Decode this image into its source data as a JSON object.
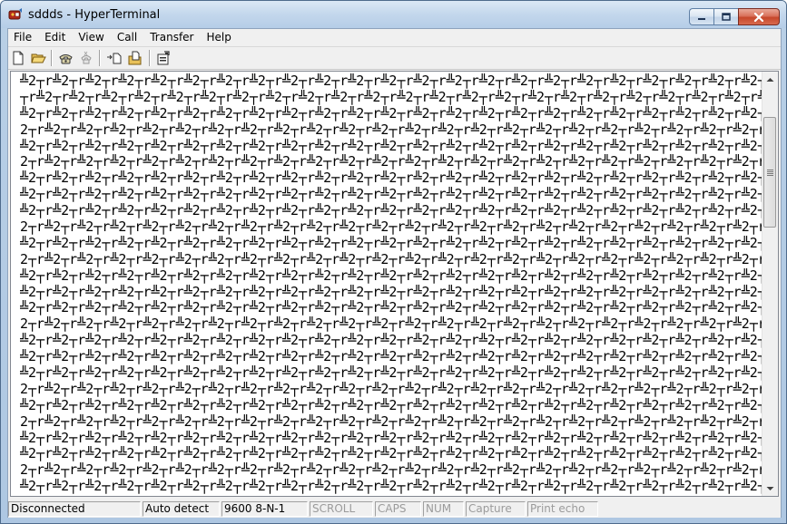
{
  "window": {
    "title": "sddds - HyperTerminal",
    "app_icon": "hyperterminal-icon",
    "caption_buttons": [
      "minimize-icon",
      "maximize-icon",
      "close-icon"
    ]
  },
  "menu": {
    "items": [
      {
        "label": "File"
      },
      {
        "label": "Edit"
      },
      {
        "label": "View"
      },
      {
        "label": "Call"
      },
      {
        "label": "Transfer"
      },
      {
        "label": "Help"
      }
    ]
  },
  "toolbar": {
    "buttons": [
      "new-connection-icon",
      "open-icon",
      "call-icon",
      "disconnect-icon",
      "send-file-icon",
      "receive-file-icon",
      "properties-icon"
    ]
  },
  "terminal": {
    "row_pattern_a": "╩2┬r╩2┬r╩2┬r╩2┬r╩2┬r╩2┬r╩2┬r╩2┬r╩2┬r╩2┬r╩2┬r╩2┬r╩2┬r╩2┬r╩2┬r╩2┬r╩2┬r╩2┬r╩2┬r╩2┬r╩2┬r╩2┬r╩2┬r╩2┬r╩2┬r",
    "row_pattern_b": "2┬r╩2┬r╩2┬r╩2┬r╩2┬r╩2┬r╩2┬r╩2┬r╩2┬r╩2┬r╩2┬r╩2┬r╩2┬r╩2┬r╩2┬r╩2┬r╩2┬r╩2┬r╩2┬r╩2┬r╩2┬r╩2┬r╩2┬r╩2┬r╩2┬r",
    "rows": [
      "╩2┬r╩2┬r╩2┬r╩2┬r╩2┬r╩2┬r╩2┬r╩2┬r╩2┬r╩2┬r╩2┬r╩2┬r╩2┬r╩2┬r╩2┬r╩2┬r╩2┬r╩2┬r╩2┬r╩2┬r╩2┬r╩2┬r╩2┬r╩2┬r╩2┬r",
      "┬r╩2┬r╩2┬r╩2┬r╩2┬r╩2┬r╩2┬r╩2┬r╩2┬r╩2┬r╩2┬r╩2┬r╩2┬r╩2┬r╩2┬r╩2┬r╩2┬r╩2┬r╩2┬r╩2┬r╩2┬r╩2┬r╩2┬r╩2┬r╩2┬r╩2",
      "╩2┬r╩2┬r╩2┬r╩2┬r╩2┬r╩2┬r╩2┬r╩2┬r╩2┬r╩2┬r╩2┬r╩2┬r╩2┬r╩2┬r╩2┬r╩2┬r╩2┬r╩2┬r╩2┬r╩2┬r╩2┬r╩2┬r╩2┬r╩2┬r╩2┬r",
      "2┬r╩2┬r╩2┬r╩2┬r╩2┬r╩2┬r╩2┬r╩2┬r╩2┬r╩2┬r╩2┬r╩2┬r╩2┬r╩2┬r╩2┬r╩2┬r╩2┬r╩2┬r╩2┬r╩2┬r╩2┬r╩2┬r╩2┬r╩2┬r╩2┬r╩",
      "╩2┬r╩2┬r╩2┬r╩2┬r╩2┬r╩2┬r╩2┬r╩2┬r╩2┬r╩2┬r╩2┬r╩2┬r╩2┬r╩2┬r╩2┬r╩2┬r╩2┬r╩2┬r╩2┬r╩2┬r╩2┬r╩2┬r╩2┬r╩2┬r╩2┬r",
      "2┬r╩2┬r╩2┬r╩2┬r╩2┬r╩2┬r╩2┬r╩2┬r╩2┬r╩2┬r╩2┬r╩2┬r╩2┬r╩2┬r╩2┬r╩2┬r╩2┬r╩2┬r╩2┬r╩2┬r╩2┬r╩2┬r╩2┬r╩2┬r╩2┬r╩",
      "╩2┬r╩2┬r╩2┬r╩2┬r╩2┬r╩2┬r╩2┬r╩2┬r╩2┬r╩2┬r╩2┬r╩2┬r╩2┬r╩2┬r╩2┬r╩2┬r╩2┬r╩2┬r╩2┬r╩2┬r╩2┬r╩2┬r╩2┬r╩2┬r╩2┬r",
      "╩2┬r╩2┬r╩2┬r╩2┬r╩2┬r╩2┬r╩2┬r╩2┬r╩2┬r╩2┬r╩2┬r╩2┬r╩2┬r╩2┬r╩2┬r╩2┬r╩2┬r╩2┬r╩2┬r╩2┬r╩2┬r╩2┬r╩2┬r╩2┬r╩2┬r",
      "╩2┬r╩2┬r╩2┬r╩2┬r╩2┬r╩2┬r╩2┬r╩2┬r╩2┬r╩2┬r╩2┬r╩2┬r╩2┬r╩2┬r╩2┬r╩2┬r╩2┬r╩2┬r╩2┬r╩2┬r╩2┬r╩2┬r╩2┬r╩2┬r╩2┬r",
      "2┬r╩2┬r╩2┬r╩2┬r╩2┬r╩2┬r╩2┬r╩2┬r╩2┬r╩2┬r╩2┬r╩2┬r╩2┬r╩2┬r╩2┬r╩2┬r╩2┬r╩2┬r╩2┬r╩2┬r╩2┬r╩2┬r╩2┬r╩2┬r╩2┬r╩",
      "╩2┬r╩2┬r╩2┬r╩2┬r╩2┬r╩2┬r╩2┬r╩2┬r╩2┬r╩2┬r╩2┬r╩2┬r╩2┬r╩2┬r╩2┬r╩2┬r╩2┬r╩2┬r╩2┬r╩2┬r╩2┬r╩2┬r╩2┬r╩2┬r╩2┬r",
      "2┬r╩2┬r╩2┬r╩2┬r╩2┬r╩2┬r╩2┬r╩2┬r╩2┬r╩2┬r╩2┬r╩2┬r╩2┬r╩2┬r╩2┬r╩2┬r╩2┬r╩2┬r╩2┬r╩2┬r╩2┬r╩2┬r╩2┬r╩2┬r╩2┬r╩",
      "╩2┬r╩2┬r╩2┬r╩2┬r╩2┬r╩2┬r╩2┬r╩2┬r╩2┬r╩2┬r╩2┬r╩2┬r╩2┬r╩2┬r╩2┬r╩2┬r╩2┬r╩2┬r╩2┬r╩2┬r╩2┬r╩2┬r╩2┬r╩2┬r╩2┬r",
      "╩2┬r╩2┬r╩2┬r╩2┬r╩2┬r╩2┬r╩2┬r╩2┬r╩2┬r╩2┬r╩2┬r╩2┬r╩2┬r╩2┬r╩2┬r╩2┬r╩2┬r╩2┬r╩2┬r╩2┬r╩2┬r╩2┬r╩2┬r╩2┬r╩2┬r",
      "╩2┬r╩2┬r╩2┬r╩2┬r╩2┬r╩2┬r╩2┬r╩2┬r╩2┬r╩2┬r╩2┬r╩2┬r╩2┬r╩2┬r╩2┬r╩2┬r╩2┬r╩2┬r╩2┬r╩2┬r╩2┬r╩2┬r╩2┬r╩2┬r╩2┬r",
      "2┬r╩2┬r╩2┬r╩2┬r╩2┬r╩2┬r╩2┬r╩2┬r╩2┬r╩2┬r╩2┬r╩2┬r╩2┬r╩2┬r╩2┬r╩2┬r╩2┬r╩2┬r╩2┬r╩2┬r╩2┬r╩2┬r╩2┬r╩2┬r╩2┬r╩",
      "╩2┬r╩2┬r╩2┬r╩2┬r╩2┬r╩2┬r╩2┬r╩2┬r╩2┬r╩2┬r╩2┬r╩2┬r╩2┬r╩2┬r╩2┬r╩2┬r╩2┬r╩2┬r╩2┬r╩2┬r╩2┬r╩2┬r╩2┬r╩2┬r╩2┬r",
      "╩2┬r╩2┬r╩2┬r╩2┬r╩2┬r╩2┬r╩2┬r╩2┬r╩2┬r╩2┬r╩2┬r╩2┬r╩2┬r╩2┬r╩2┬r╩2┬r╩2┬r╩2┬r╩2┬r╩2┬r╩2┬r╩2┬r╩2┬r╩2┬r╩2┬r",
      "╩2┬r╩2┬r╩2┬r╩2┬r╩2┬r╩2┬r╩2┬r╩2┬r╩2┬r╩2┬r╩2┬r╩2┬r╩2┬r╩2┬r╩2┬r╩2┬r╩2┬r╩2┬r╩2┬r╩2┬r╩2┬r╩2┬r╩2┬r╩2┬r╩2┬r",
      "2┬r╩2┬r╩2┬r╩2┬r╩2┬r╩2┬r╩2┬r╩2┬r╩2┬r╩2┬r╩2┬r╩2┬r╩2┬r╩2┬r╩2┬r╩2┬r╩2┬r╩2┬r╩2┬r╩2┬r╩2┬r╩2┬r╩2┬r╩2┬r╩2┬r╩",
      "╩2┬r╩2┬r╩2┬r╩2┬r╩2┬r╩2┬r╩2┬r╩2┬r╩2┬r╩2┬r╩2┬r╩2┬r╩2┬r╩2┬r╩2┬r╩2┬r╩2┬r╩2┬r╩2┬r╩2┬r╩2┬r╩2┬r╩2┬r╩2┬r╩2┬r",
      "2┬r╩2┬r╩2┬r╩2┬r╩2┬r╩2┬r╩2┬r╩2┬r╩2┬r╩2┬r╩2┬r╩2┬r╩2┬r╩2┬r╩2┬r╩2┬r╩2┬r╩2┬r╩2┬r╩2┬r╩2┬r╩2┬r╩2┬r╩2┬r╩2┬r╩",
      "╩2┬r╩2┬r╩2┬r╩2┬r╩2┬r╩2┬r╩2┬r╩2┬r╩2┬r╩2┬r╩2┬r╩2┬r╩2┬r╩2┬r╩2┬r╩2┬r╩2┬r╩2┬r╩2┬r╩2┬r╩2┬r╩2┬r╩2┬r╩2┬r╩2┬r",
      "╩2┬r╩2┬r╩2┬r╩2┬r╩2┬r╩2┬r╩2┬r╩2┬r╩2┬r╩2┬r╩2┬r╩2┬r╩2┬r╩2┬r╩2┬r╩2┬r╩2┬r╩2┬r╩2┬r╩2┬r╩2┬r╩2┬r╩2┬r╩2┬r╩2┬r",
      "2┬r╩2┬r╩2┬r╩2┬r╩2┬r╩2┬r╩2┬r╩2┬r╩2┬r╩2┬r╩2┬r╩2┬r╩2┬r╩2┬r╩2┬r╩2┬r╩2┬r╩2┬r╩2┬r╩2┬r╩2┬r╩2┬r╩2┬r╩2┬r╩2┬r╩",
      "╩2┬r╩2┬r╩2┬r╩2┬r╩2┬r╩2┬r╩2┬r╩2┬r╩2┬r╩2┬r╩2┬r╩2┬r╩2┬r╩2┬r╩2┬r╩2┬r╩2┬r╩2┬r╩2┬r╩2┬r╩2┬r╩2┬r╩2┬r╩2┬r╩2┬r"
    ]
  },
  "statusbar": {
    "connection": "Disconnected",
    "detect": "Auto detect",
    "settings": "9600 8-N-1",
    "scroll": "SCROLL",
    "caps": "CAPS",
    "num": "NUM",
    "capture": "Capture",
    "print_echo": "Print echo"
  }
}
